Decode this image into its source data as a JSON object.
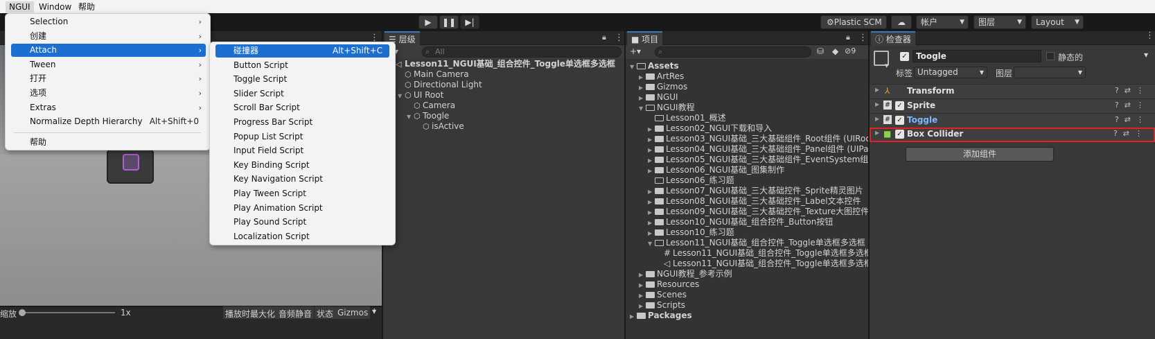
{
  "menubar": {
    "items": [
      "NGUI",
      "Window",
      "帮助"
    ]
  },
  "toolbar": {
    "plastic": "Plastic SCM",
    "account": "帐户",
    "layers": "图层",
    "layout": "Layout"
  },
  "scene_bottom": {
    "zoom_label": "缩放",
    "zoom_value": "1x",
    "buttons": [
      "播放时最大化",
      "音频静音",
      "状态",
      "Gizmos"
    ]
  },
  "hierarchy": {
    "tab": "层级",
    "search_placeholder": "All",
    "items": [
      {
        "label": "Lesson11_NGUI基础_组合控件_Toggle单选框多选框",
        "indent": 0,
        "type": "scene",
        "expanded": true
      },
      {
        "label": "Main Camera",
        "indent": 1,
        "type": "object"
      },
      {
        "label": "Directional Light",
        "indent": 1,
        "type": "object"
      },
      {
        "label": "UI Root",
        "indent": 1,
        "type": "object",
        "expanded": true
      },
      {
        "label": "Camera",
        "indent": 2,
        "type": "object"
      },
      {
        "label": "Toogle",
        "indent": 2,
        "type": "object",
        "expanded": true,
        "selected": true
      },
      {
        "label": "isActive",
        "indent": 3,
        "type": "object"
      }
    ]
  },
  "project": {
    "tab": "项目",
    "hidden_count": "9",
    "items": [
      {
        "label": "Assets",
        "indent": 0,
        "type": "folder-open",
        "bold": true
      },
      {
        "label": "ArtRes",
        "indent": 1,
        "type": "folder"
      },
      {
        "label": "Gizmos",
        "indent": 1,
        "type": "folder"
      },
      {
        "label": "NGUI",
        "indent": 1,
        "type": "folder"
      },
      {
        "label": "NGUI教程",
        "indent": 1,
        "type": "folder-open"
      },
      {
        "label": "Lesson01_概述",
        "indent": 2,
        "type": "folder-empty"
      },
      {
        "label": "Lesson02_NGUI下载和导入",
        "indent": 2,
        "type": "folder"
      },
      {
        "label": "Lesson03_NGUI基础_三大基础组件_Root组件 (UIRoot)",
        "indent": 2,
        "type": "folder"
      },
      {
        "label": "Lesson04_NGUI基础_三大基础组件_Panel组件 (UIPanel)",
        "indent": 2,
        "type": "folder"
      },
      {
        "label": "Lesson05_NGUI基础_三大基础组件_EventSystem组件 (U",
        "indent": 2,
        "type": "folder"
      },
      {
        "label": "Lesson06_NGUI基础_图集制作",
        "indent": 2,
        "type": "folder"
      },
      {
        "label": "Lesson06_练习题",
        "indent": 2,
        "type": "folder-empty"
      },
      {
        "label": "Lesson07_NGUI基础_三大基础控件_Sprite精灵图片",
        "indent": 2,
        "type": "folder"
      },
      {
        "label": "Lesson08_NGUI基础_三大基础控件_Label文本控件",
        "indent": 2,
        "type": "folder"
      },
      {
        "label": "Lesson09_NGUI基础_三大基础控件_Texture大图控件",
        "indent": 2,
        "type": "folder"
      },
      {
        "label": "Lesson10_NGUI基础_组合控件_Button按钮",
        "indent": 2,
        "type": "folder"
      },
      {
        "label": "Lesson10_练习题",
        "indent": 2,
        "type": "folder"
      },
      {
        "label": "Lesson11_NGUI基础_组合控件_Toggle单选框多选框",
        "indent": 2,
        "type": "folder-open"
      },
      {
        "label": "Lesson11_NGUI基础_组合控件_Toggle单选框多选框",
        "indent": 3,
        "type": "script"
      },
      {
        "label": "Lesson11_NGUI基础_组合控件_Toggle单选框多选框",
        "indent": 3,
        "type": "unity"
      },
      {
        "label": "NGUI教程_参考示例",
        "indent": 1,
        "type": "folder"
      },
      {
        "label": "Resources",
        "indent": 1,
        "type": "folder"
      },
      {
        "label": "Scenes",
        "indent": 1,
        "type": "folder"
      },
      {
        "label": "Scripts",
        "indent": 1,
        "type": "folder"
      },
      {
        "label": "Packages",
        "indent": 0,
        "type": "folder",
        "bold": true
      }
    ]
  },
  "inspector": {
    "tab": "检查器",
    "object_name": "Toogle",
    "static_label": "静态的",
    "tag_label": "标签",
    "tag_value": "Untagged",
    "layer_label": "图层",
    "layer_value": "",
    "components": [
      "Transform",
      "Sprite",
      "Toggle",
      "Box Collider"
    ],
    "add_component": "添加组件",
    "highlight_color": "#e02424"
  },
  "menu_main": {
    "items": [
      {
        "label": "Selection",
        "submenu": true
      },
      {
        "label": "创建",
        "submenu": true
      },
      {
        "label": "Attach",
        "submenu": true,
        "highlighted": true
      },
      {
        "label": "Tween",
        "submenu": true
      },
      {
        "label": "打开",
        "submenu": true
      },
      {
        "label": "选项",
        "submenu": true
      },
      {
        "label": "Extras",
        "submenu": true
      },
      {
        "label": "Normalize Depth Hierarchy",
        "shortcut": "Alt+Shift+0"
      },
      {
        "label": "帮助"
      }
    ]
  },
  "menu_attach": {
    "items": [
      {
        "label": "碰撞器",
        "shortcut": "Alt+Shift+C",
        "highlighted": true
      },
      {
        "label": "Button Script"
      },
      {
        "label": "Toggle Script"
      },
      {
        "label": "Slider Script"
      },
      {
        "label": "Scroll Bar Script"
      },
      {
        "label": "Progress Bar Script"
      },
      {
        "label": "Popup List Script"
      },
      {
        "label": "Input Field Script"
      },
      {
        "label": "Key Binding Script"
      },
      {
        "label": "Key Navigation Script"
      },
      {
        "label": "Play Tween Script"
      },
      {
        "label": "Play Animation Script"
      },
      {
        "label": "Play Sound Script"
      },
      {
        "label": "Localization Script"
      }
    ]
  },
  "colors": {
    "accent": "#3a79bb",
    "menu_highlight": "#1c6fd1",
    "toggle_label": "#7fb6ff"
  }
}
